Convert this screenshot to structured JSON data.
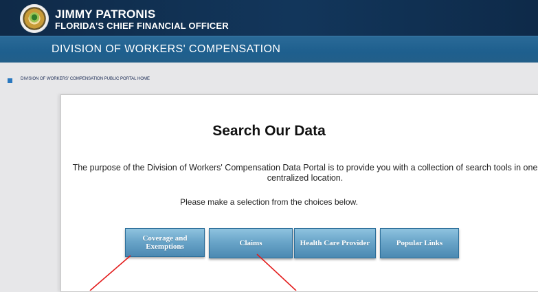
{
  "header": {
    "name": "JIMMY PATRONIS",
    "title": "FLORIDA'S CHIEF FINANCIAL OFFICER",
    "seal_icon": "florida-cfo-seal-icon"
  },
  "division_bar": {
    "text": "DIVISION OF WORKERS' COMPENSATION"
  },
  "breadcrumb": {
    "link": "DIVISION OF WORKERS' COMPENSATION PUBLIC PORTAL HOME"
  },
  "main": {
    "heading": "Search Our Data",
    "description": "The purpose of the Division of Workers' Compensation Data Portal is to provide you with a collection of search tools in one centralized location.",
    "prompt": "Please make a selection from the choices below.",
    "buttons": [
      {
        "label": "Coverage and Exemptions"
      },
      {
        "label": "Claims"
      },
      {
        "label": "Health Care Provider"
      },
      {
        "label": "Popular Links"
      }
    ]
  },
  "colors": {
    "header_navy": "#12365b",
    "division_blue": "#1e5f8e",
    "button_blue": "#6aa5c9",
    "annotation_red": "#e31b1b"
  }
}
